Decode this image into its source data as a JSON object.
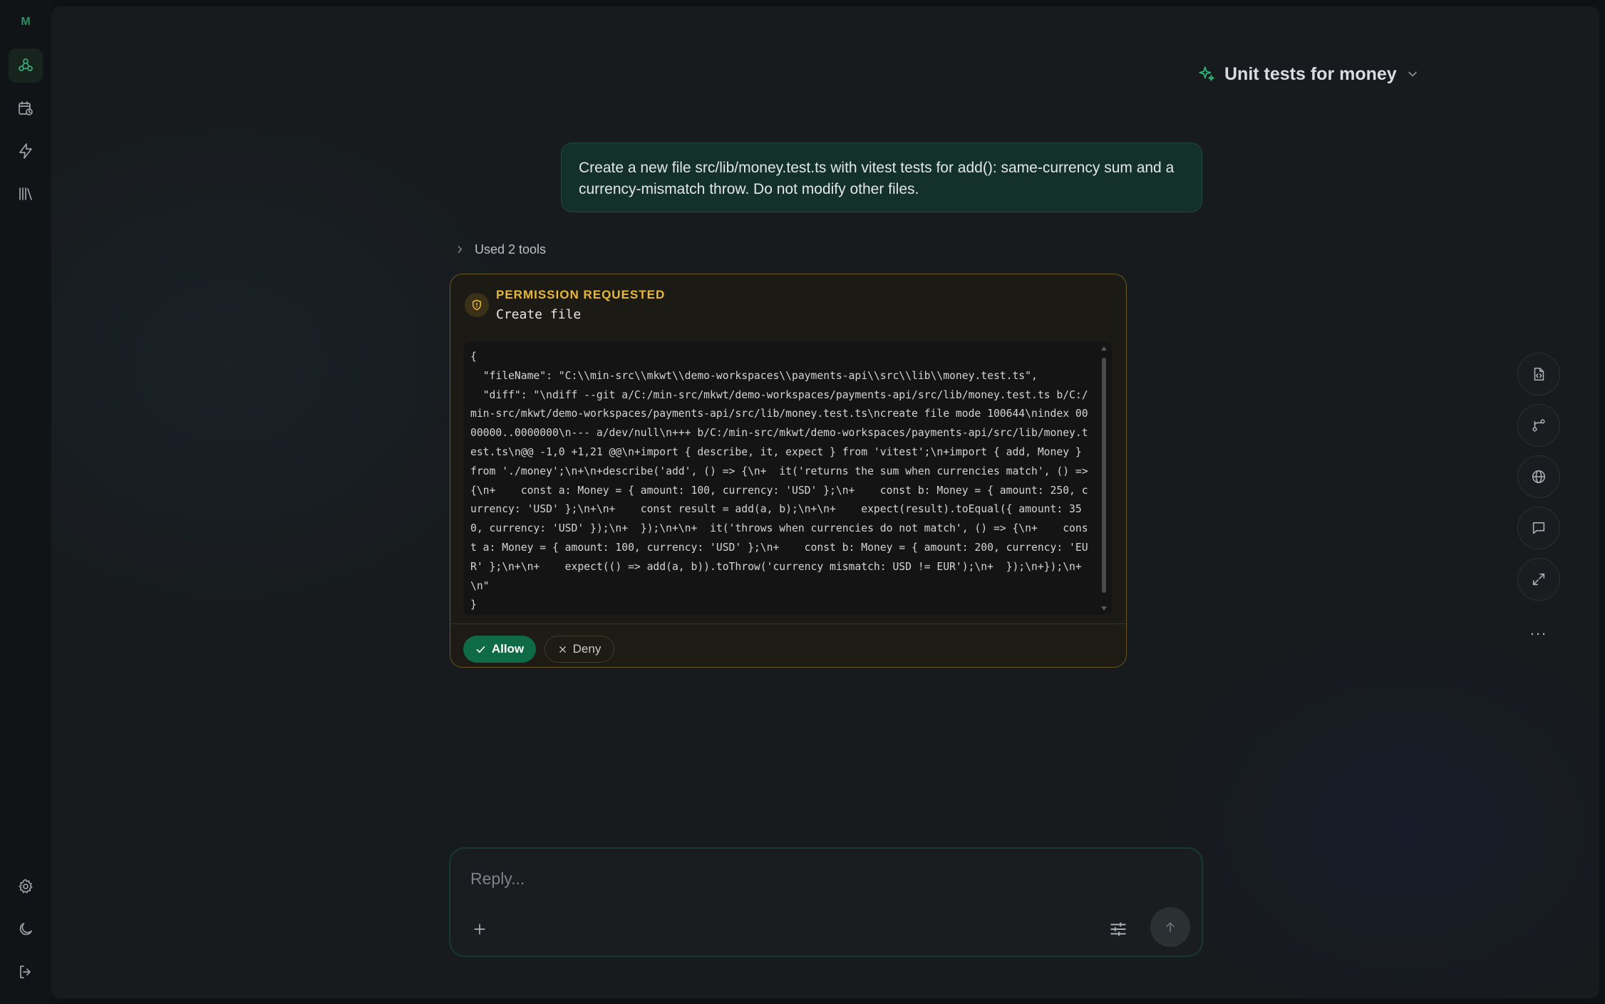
{
  "sidebar": {
    "brand": "M",
    "nav": [
      {
        "icon": "agents-icon",
        "active": true
      },
      {
        "icon": "calendar-clock-icon",
        "active": false
      },
      {
        "icon": "lightning-icon",
        "active": false
      },
      {
        "icon": "library-icon",
        "active": false
      }
    ],
    "bottom": [
      {
        "icon": "gear-icon"
      },
      {
        "icon": "moon-icon"
      },
      {
        "icon": "logout-icon"
      }
    ]
  },
  "header": {
    "title": "Unit tests for money",
    "title_icon": "sparkles-icon",
    "dropdown_icon": "chevron-down-icon"
  },
  "conversation": {
    "user_message": "Create a new file src/lib/money.test.ts with vitest tests for add(): same-currency sum and a currency-mismatch throw. Do not modify other files.",
    "tools_summary": "Used 2 tools"
  },
  "permission": {
    "label": "PERMISSION REQUESTED",
    "action": "Create file",
    "payload": "{\n  \"fileName\": \"C:\\\\min-src\\\\mkwt\\\\demo-workspaces\\\\payments-api\\\\src\\\\lib\\\\money.test.ts\",\n  \"diff\": \"\\ndiff --git a/C:/min-src/mkwt/demo-workspaces/payments-api/src/lib/money.test.ts b/C:/min-src/mkwt/demo-workspaces/payments-api/src/lib/money.test.ts\\ncreate file mode 100644\\nindex 0000000..0000000\\n--- a/dev/null\\n+++ b/C:/min-src/mkwt/demo-workspaces/payments-api/src/lib/money.test.ts\\n@@ -1,0 +1,21 @@\\n+import { describe, it, expect } from 'vitest';\\n+import { add, Money } from './money';\\n+\\n+describe('add', () => {\\n+  it('returns the sum when currencies match', () => {\\n+    const a: Money = { amount: 100, currency: 'USD' };\\n+    const b: Money = { amount: 250, currency: 'USD' };\\n+\\n+    const result = add(a, b);\\n+\\n+    expect(result).toEqual({ amount: 350, currency: 'USD' });\\n+  });\\n+\\n+  it('throws when currencies do not match', () => {\\n+    const a: Money = { amount: 100, currency: 'USD' };\\n+    const b: Money = { amount: 200, currency: 'EUR' };\\n+\\n+    expect(() => add(a, b)).toThrow('currency mismatch: USD != EUR');\\n+  });\\n+});\\n+\\n\"\n}",
    "allow_label": "Allow",
    "deny_label": "Deny"
  },
  "right_rail": [
    {
      "icon": "file-code-icon"
    },
    {
      "icon": "git-branch-icon"
    },
    {
      "icon": "globe-icon"
    },
    {
      "icon": "message-square-icon"
    },
    {
      "icon": "expand-icon"
    }
  ],
  "right_rail_more": "...",
  "composer": {
    "placeholder": "Reply..."
  },
  "colors": {
    "accent": "#0f6b45",
    "warning": "#e8b83a",
    "user_bubble": "#14302a"
  }
}
